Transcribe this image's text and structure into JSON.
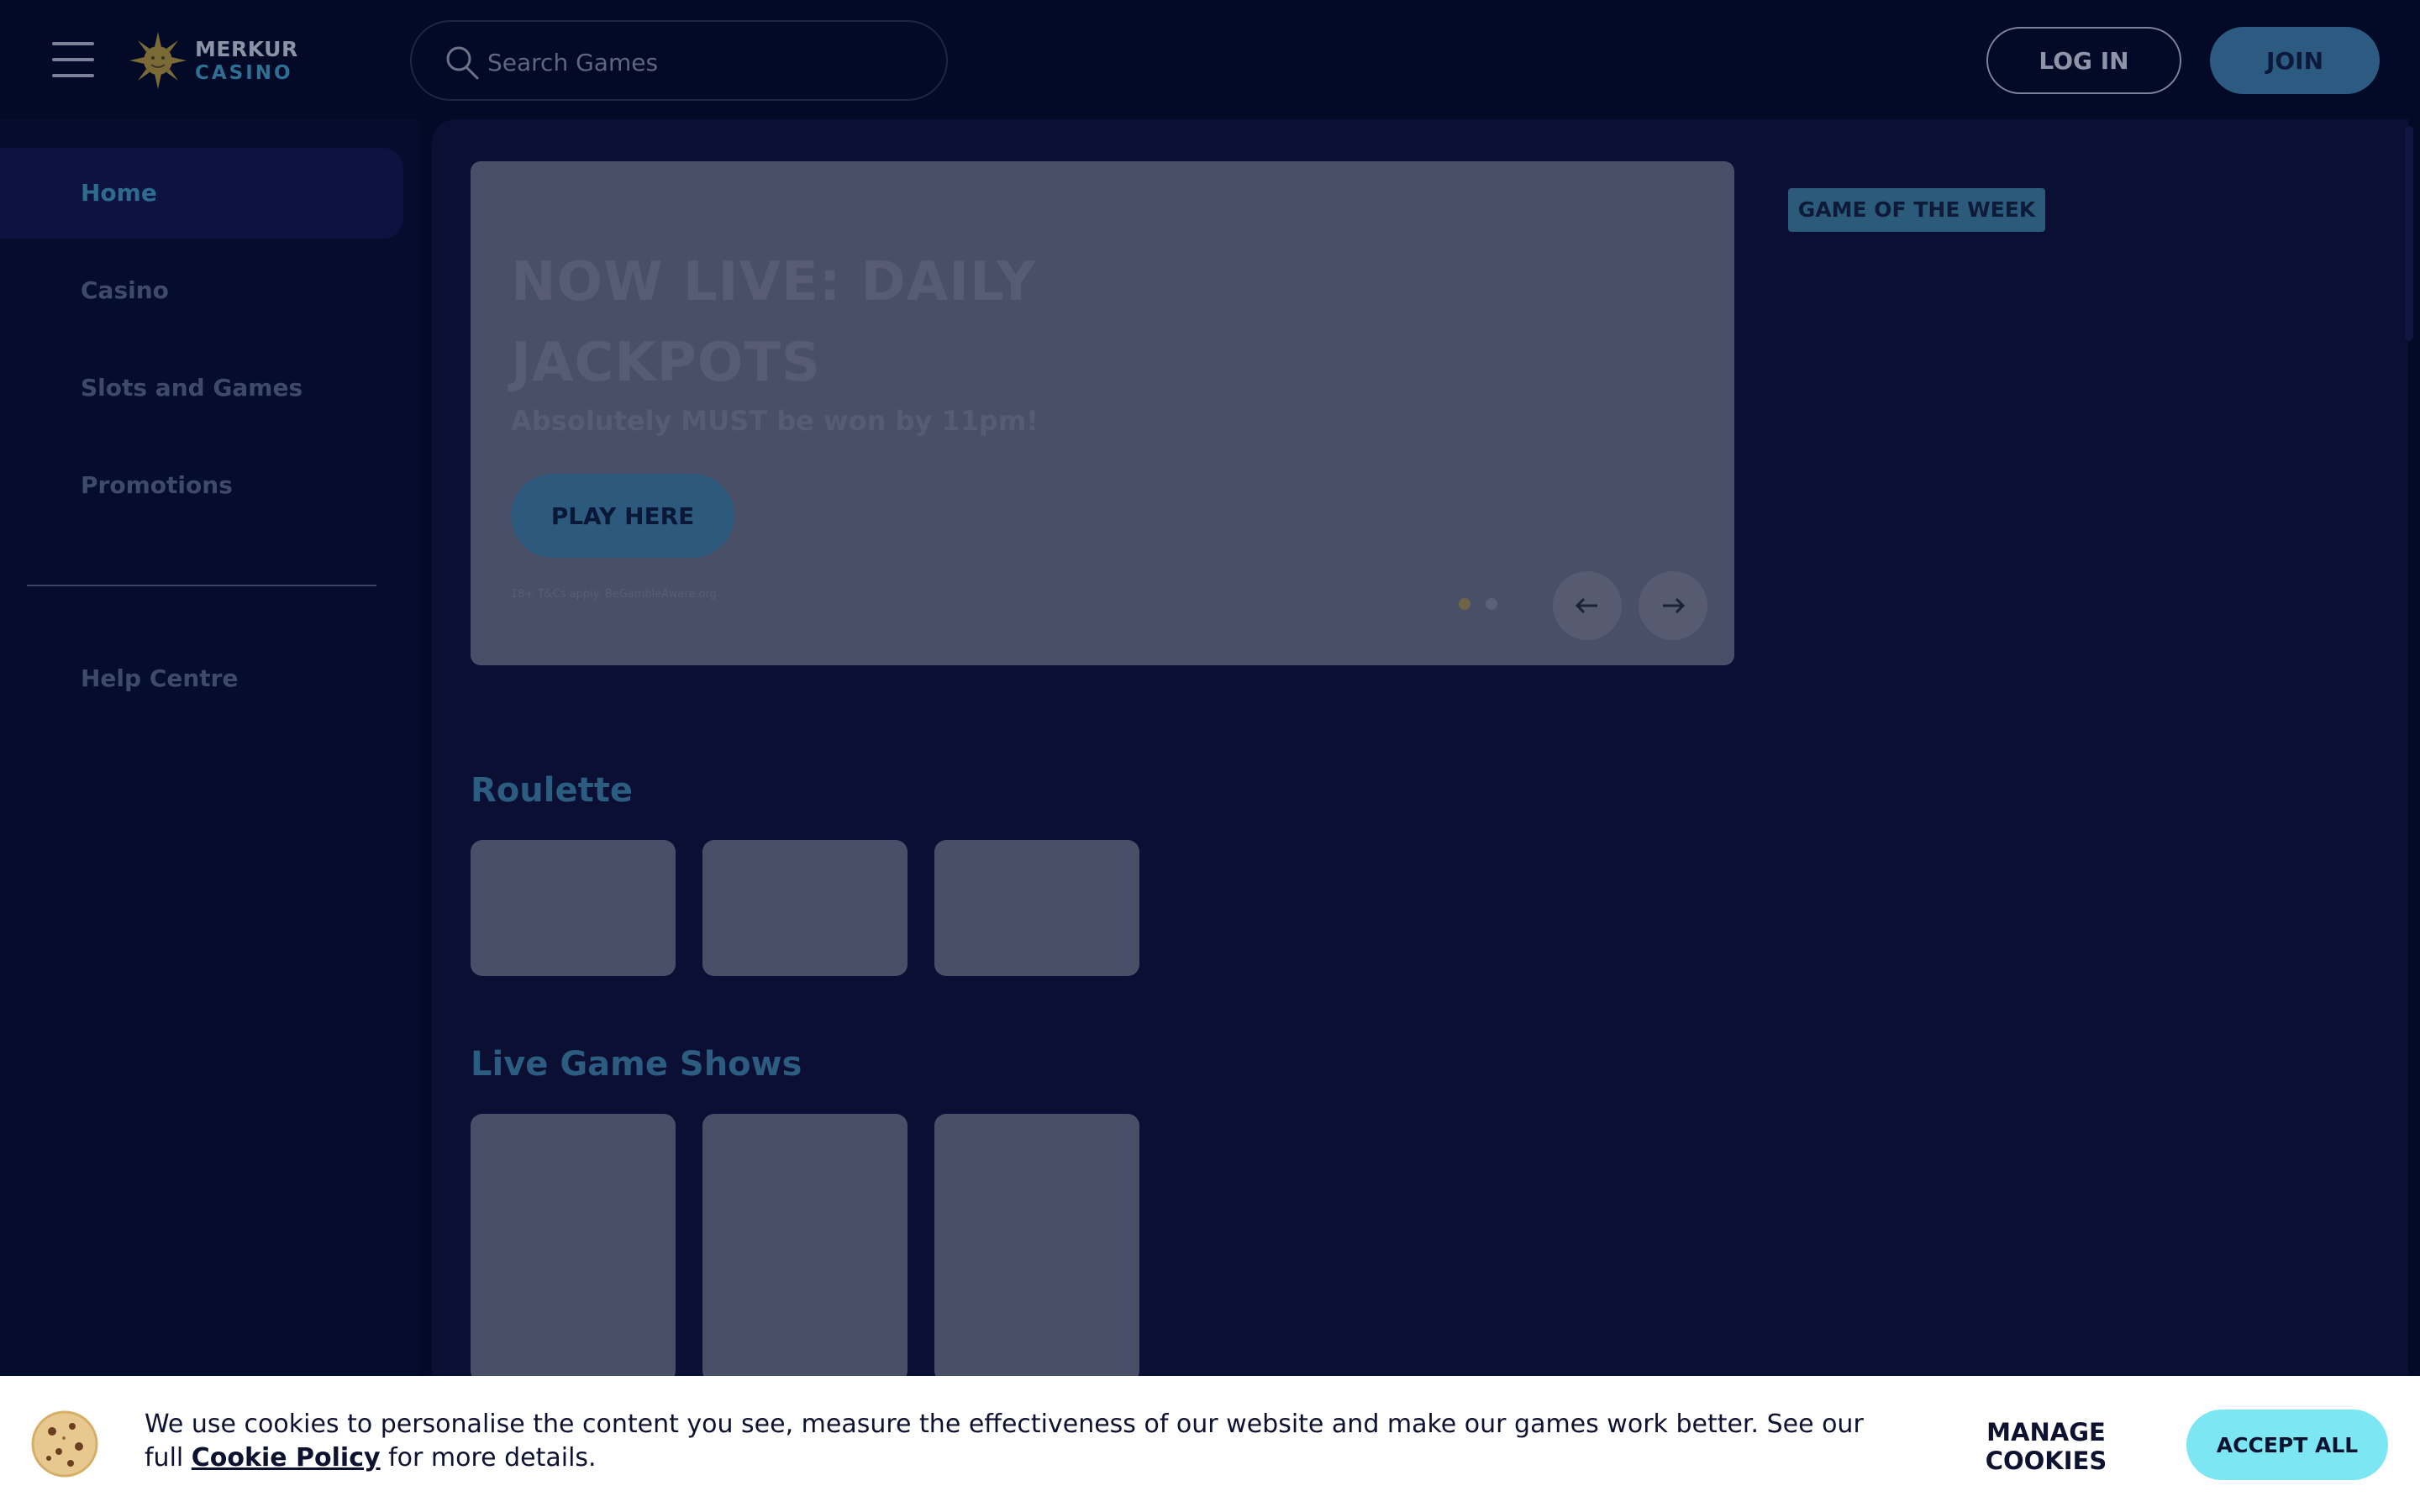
{
  "header": {
    "logo_line1": "MERKUR",
    "logo_line2": "CASINO",
    "search_placeholder": "Search Games",
    "login_label": "LOG IN",
    "join_label": "JOIN"
  },
  "sidebar": {
    "items": [
      {
        "label": "Home",
        "active": true
      },
      {
        "label": "Casino"
      },
      {
        "label": "Slots and Games"
      },
      {
        "label": "Promotions"
      }
    ],
    "help_label": "Help Centre"
  },
  "banner": {
    "title": "NOW LIVE: DAILY JACKPOTS",
    "subtitle": "Absolutely MUST be won by 11pm!",
    "cta_label": "PLAY HERE",
    "terms": "18+ T&Cs apply. BeGambleAware.org"
  },
  "game_of_week_label": "GAME OF THE WEEK",
  "sections": [
    {
      "title": "Roulette"
    },
    {
      "title": "Live Game Shows"
    }
  ],
  "cookie": {
    "text_before": "We use cookies to personalise the content you see, measure the effectiveness of our website and make our games work better. See our full ",
    "link_label": "Cookie Policy",
    "text_after": " for more details.",
    "manage_label": "MANAGE COOKIES",
    "accept_label": "ACCEPT ALL"
  },
  "colors": {
    "background": "#030a28",
    "accent": "#2c5a80",
    "cookie_accept": "#7de6f3"
  }
}
